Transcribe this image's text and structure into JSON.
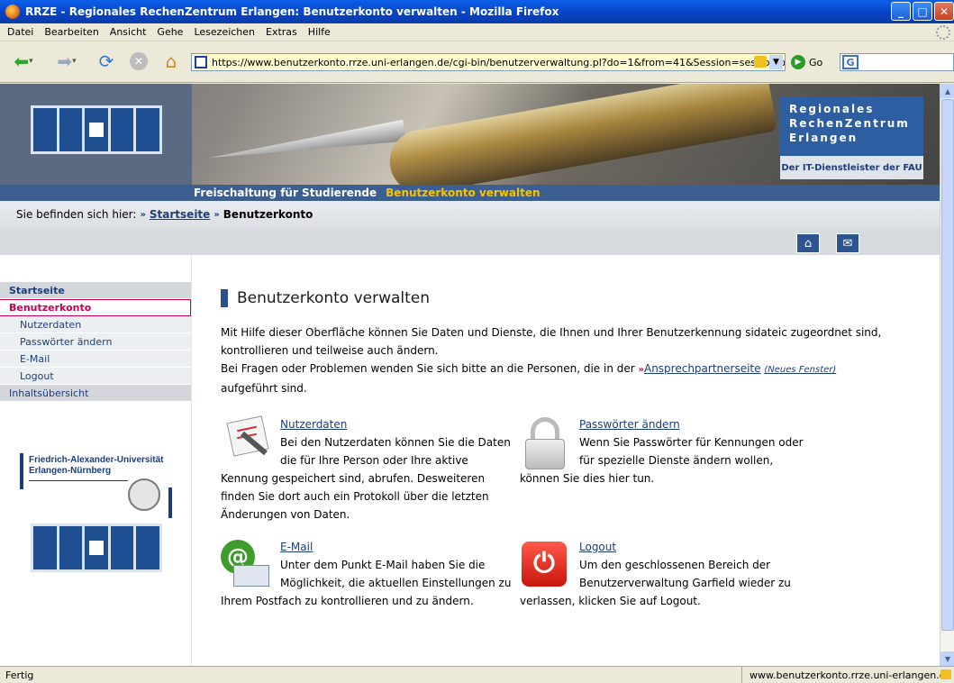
{
  "window": {
    "title": "RRZE - Regionales RechenZentrum Erlangen: Benutzerkonto verwalten - Mozilla Firefox",
    "buttons": {
      "minimize": "_",
      "maximize": "□",
      "close": "✕"
    }
  },
  "menu": [
    "Datei",
    "Bearbeiten",
    "Ansicht",
    "Gehe",
    "Lesezeichen",
    "Extras",
    "Hilfe"
  ],
  "toolbar": {
    "url": "https://www.benutzerkonto.rrze.uni-erlangen.de/cgi-bin/benutzerverwaltung.pl?do=1&from=41&Session=session.benu",
    "go_label": "Go"
  },
  "header": {
    "brand_lines": [
      "Regionales",
      "RechenZentrum",
      "Erlangen"
    ],
    "brand_sub": "Der IT-Dienstleister der FAU",
    "nav_primary": "Freischaltung für Studierende",
    "nav_secondary": "Benutzerkonto verwalten"
  },
  "breadcrumb": {
    "prefix": "Sie befinden sich hier:",
    "home": "Startseite",
    "current": "Benutzerkonto"
  },
  "sidebar": {
    "items": [
      {
        "label": "Startseite"
      },
      {
        "label": "Benutzerkonto"
      },
      {
        "label": "Nutzerdaten"
      },
      {
        "label": "Passwörter ändern"
      },
      {
        "label": "E-Mail"
      },
      {
        "label": "Logout"
      },
      {
        "label": "Inhaltsübersicht"
      }
    ],
    "fau_line1": "Friedrich-Alexander-Universität",
    "fau_line2": "Erlangen-Nürnberg"
  },
  "main": {
    "title": "Benutzerkonto verwalten",
    "intro_1": "Mit Hilfe dieser Oberfläche können Sie Daten und Dienste, die Ihnen und Ihrer Benutzerkennung sidateic zugeordnet sind, kontrollieren und teilweise auch ändern.",
    "intro_2": "Bei Fragen oder Problemen wenden Sie sich bitte an die Personen, die in der",
    "intro_link": "Ansprechpartnerseite",
    "intro_link_note": "(Neues Fenster)",
    "intro_3": "aufgeführt sind.",
    "features": [
      {
        "title": "Nutzerdaten",
        "text": "Bei den Nutzerdaten können Sie die Daten die für Ihre Person oder Ihre aktive Kennung gespeichert sind, abrufen. Desweiteren finden Sie dort auch ein Protokoll über die letzten Änderungen von Daten."
      },
      {
        "title": "Passwörter ändern",
        "text": "Wenn Sie Passwörter für Kennungen oder für spezielle Dienste ändern wollen, können Sie dies hier tun."
      },
      {
        "title": "E-Mail",
        "text": "Unter dem Punkt E-Mail haben Sie die Möglichkeit, die aktuellen Einstellungen zu Ihrem Postfach zu kontrollieren und zu ändern."
      },
      {
        "title": "Logout",
        "text": "Um den geschlossenen Bereich der Benutzerverwaltung Garfield wieder zu verlassen, klicken Sie auf Logout."
      }
    ]
  },
  "status": {
    "left": "Fertig",
    "right": "www.benutzerkonto.rrze.uni-erlangen.de"
  }
}
